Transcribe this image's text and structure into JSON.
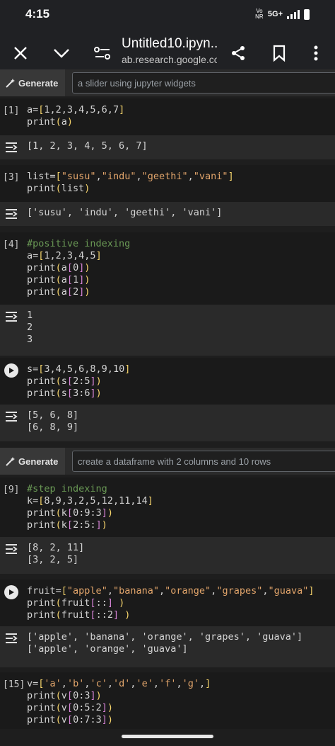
{
  "status": {
    "time": "4:15",
    "network": "5G+",
    "volte": "Vo NR"
  },
  "toolbar": {
    "title": "Untitled10.ipyn...",
    "url": "ab.research.google.com"
  },
  "generate1": {
    "label": "Generate",
    "placeholder": "a slider using jupyter widgets"
  },
  "generate2": {
    "label": "Generate",
    "placeholder": "create a dataframe with 2 columns and 10 rows"
  },
  "cells": [
    {
      "number": "[1]",
      "output": "[1, 2, 3, 4, 5, 6, 7]"
    },
    {
      "number": "[3]",
      "output": "['susu', 'indu', 'geethi', 'vani']"
    },
    {
      "number": "[4]",
      "output": "1\n2\n3"
    },
    {
      "number": "",
      "output": "[5, 6, 8]\n[6, 8, 9]"
    },
    {
      "number": "[9]",
      "output": "[8, 2, 11]\n[3, 2, 5]"
    },
    {
      "number": "",
      "output": "['apple', 'banana', 'orange', 'grapes', 'guava']\n['apple', 'orange', 'guava']"
    },
    {
      "number": "[15]",
      "output": ""
    }
  ],
  "code": {
    "c1_l1_a": "a=",
    "c1_l1_b": "[",
    "c1_l1_c": "1,2,3,4,5,6,7",
    "c1_l1_d": "]",
    "c1_l2_a": "print",
    "c1_l2_b": "(",
    "c1_l2_c": "a",
    "c1_l2_d": ")",
    "c2_l1_a": "list=",
    "c2_l1_b": "[",
    "c2_l1_s1": "\"susu\"",
    "c2_l1_s2": "\"indu\"",
    "c2_l1_s3": "\"geethi\"",
    "c2_l1_s4": "\"vani\"",
    "c2_l1_d": "]",
    "c2_l2_a": "print",
    "c2_l2_b": "(",
    "c2_l2_c": "list",
    "c2_l2_d": ")",
    "c3_l1": "#positive indexing",
    "c3_l2_a": "a=",
    "c3_l2_b": "[",
    "c3_l2_c": "1,2,3,4,5",
    "c3_l2_d": "]",
    "c3_l3": "print",
    "c3_l3_i": "0",
    "c3_l4": "print",
    "c3_l4_i": "1",
    "c3_l5": "print",
    "c3_l5_i": "2",
    "c4_l1_a": "s=",
    "c4_l1_c": "3,4,5,6,8,9,10",
    "c4_l2_i": "2:5",
    "c4_l3_i": "3:6",
    "c5_l1": "#step indexing",
    "c5_l2_a": "k=",
    "c5_l2_c": "8,9,3,2,5,12,11,14",
    "c5_l3_i": "0:9:3",
    "c5_l4_i": "2:5:",
    "c6_l1_a": "fruit=",
    "c6_s1": "\"apple\"",
    "c6_s2": "\"banana\"",
    "c6_s3": "\"orange\"",
    "c6_s4": "\"grapes\"",
    "c6_s5": "\"guava\"",
    "c6_l2_i": "::",
    "c6_l3_i": "::2",
    "c7_l1_a": "v=",
    "c7_s1": "'a'",
    "c7_s2": "'b'",
    "c7_s3": "'c'",
    "c7_s4": "'d'",
    "c7_s5": "'e'",
    "c7_s6": "'f'",
    "c7_s7": "'g'",
    "c7_l2_i": "0:3",
    "c7_l3_i": "0:5:2",
    "c7_l4_i": "0:7:3"
  },
  "colors": {
    "background": "#1e1e1e",
    "code_bg": "#1a1a1a",
    "output_bg": "#2a2a2a",
    "bracket1": "#f7d56c",
    "bracket2": "#d684d6",
    "string": "#e2a56b",
    "comment": "#6a9955"
  }
}
